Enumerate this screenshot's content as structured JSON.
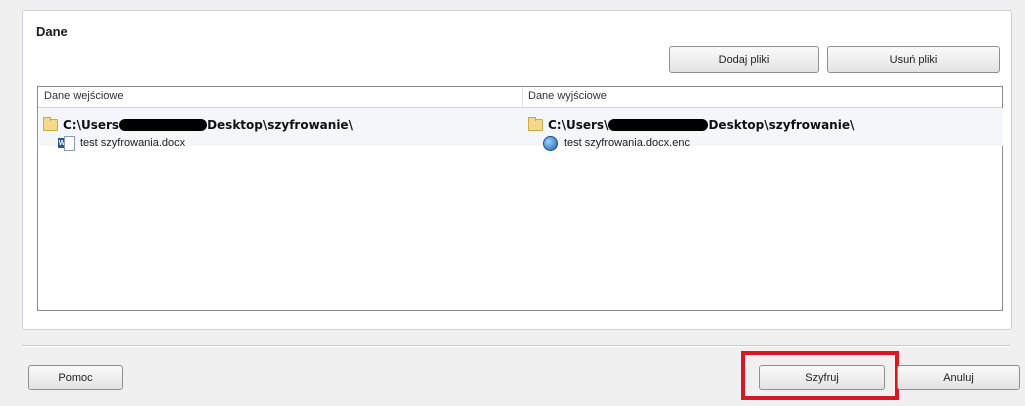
{
  "group": {
    "title": "Dane"
  },
  "buttons": {
    "add_files": "Dodaj pliki",
    "remove_files": "Usuń pliki",
    "help": "Pomoc",
    "encrypt": "Szyfruj",
    "cancel": "Anuluj"
  },
  "list": {
    "columns": [
      "Dane wejściowe",
      "Dane wyjściowe"
    ],
    "input": {
      "folder_prefix": "C:\\Users",
      "folder_suffix": "Desktop\\szyfrowanie\\",
      "file": "test szyfrowania.docx",
      "file_icon": "word-document-icon"
    },
    "output": {
      "folder_prefix": "C:\\Users\\",
      "folder_suffix": "Desktop\\szyfrowanie\\",
      "file": "test szyfrowania.docx.enc",
      "file_icon": "encrypted-file-icon"
    }
  },
  "colors": {
    "highlight": "#d81820"
  }
}
